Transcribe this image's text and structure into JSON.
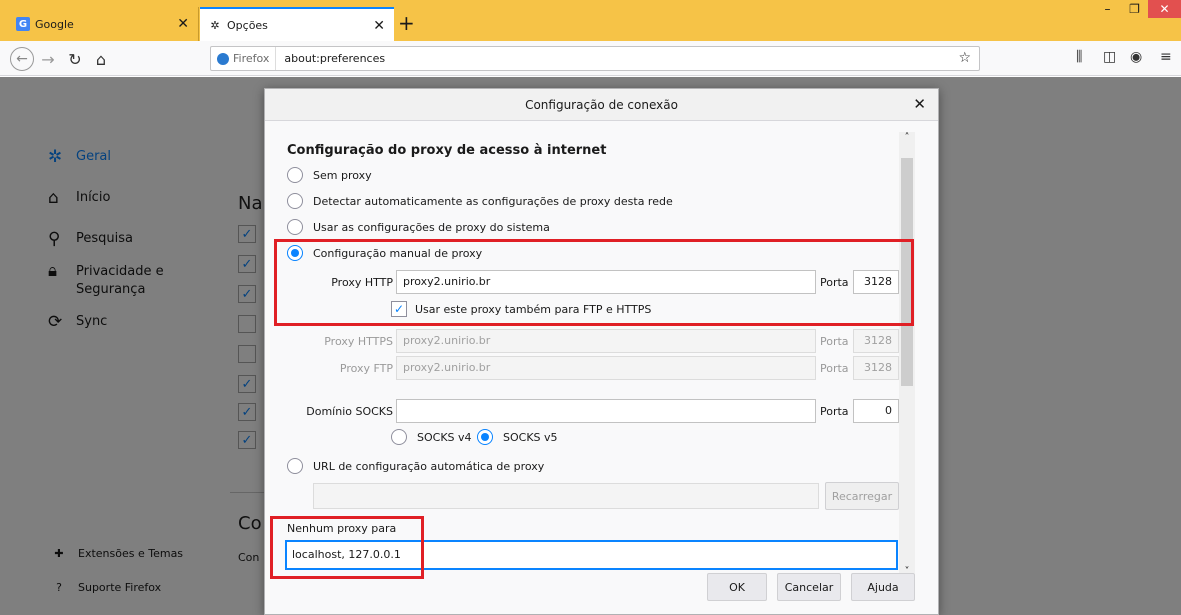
{
  "tabs": [
    {
      "label": "Google",
      "icon": "google-icon"
    },
    {
      "label": "Opções",
      "icon": "gear-icon"
    }
  ],
  "toolbar": {
    "identity": "Firefox",
    "url": "about:preferences"
  },
  "sidebar": {
    "items": [
      {
        "label": "Geral",
        "icon": "gear-icon"
      },
      {
        "label": "Início",
        "icon": "home-icon"
      },
      {
        "label": "Pesquisa",
        "icon": "search-icon"
      },
      {
        "label": "Privacidade e Segurança",
        "icon": "lock-icon"
      },
      {
        "label": "Sync",
        "icon": "sync-icon"
      }
    ],
    "bottom": [
      {
        "label": "Extensões e Temas",
        "icon": "puzzle-icon"
      },
      {
        "label": "Suporte Firefox",
        "icon": "help-icon"
      }
    ]
  },
  "background": {
    "partial_heading_1": "Na",
    "partial_heading_2": "Co",
    "partial_text": "Con"
  },
  "dialog": {
    "title": "Configuração de conexão",
    "section_title": "Configuração do proxy de acesso à internet",
    "options": {
      "no_proxy": "Sem proxy",
      "auto_detect": "Detectar automaticamente as configurações de proxy desta rede",
      "system": "Usar as configurações de proxy do sistema",
      "manual": "Configuração manual de proxy",
      "auto_url": "URL de configuração automática de proxy"
    },
    "selected_option": "manual",
    "http_proxy": {
      "label": "Proxy HTTP",
      "value": "proxy2.unirio.br",
      "port_label": "Porta",
      "port": "3128"
    },
    "use_for_all": {
      "label": "Usar este proxy também para FTP e HTTPS",
      "checked": true
    },
    "https_proxy": {
      "label": "Proxy HTTPS",
      "value": "proxy2.unirio.br",
      "port_label": "Porta",
      "port": "3128"
    },
    "ftp_proxy": {
      "label": "Proxy FTP",
      "value": "proxy2.unirio.br",
      "port_label": "Porta",
      "port": "3128"
    },
    "socks": {
      "label": "Domínio SOCKS",
      "value": "",
      "port_label": "Porta",
      "port": "0",
      "v4": "SOCKS v4",
      "v5": "SOCKS v5",
      "selected": "v5"
    },
    "auto_url_value": "",
    "reload_button": "Recarregar",
    "no_proxy_for": {
      "label": "Nenhum proxy para",
      "value": "localhost, 127.0.0.1"
    },
    "buttons": {
      "ok": "OK",
      "cancel": "Cancelar",
      "help": "Ajuda"
    }
  },
  "colors": {
    "accent": "#0a84ff",
    "highlight": "#e01f25",
    "tabbar": "#f6c347"
  }
}
